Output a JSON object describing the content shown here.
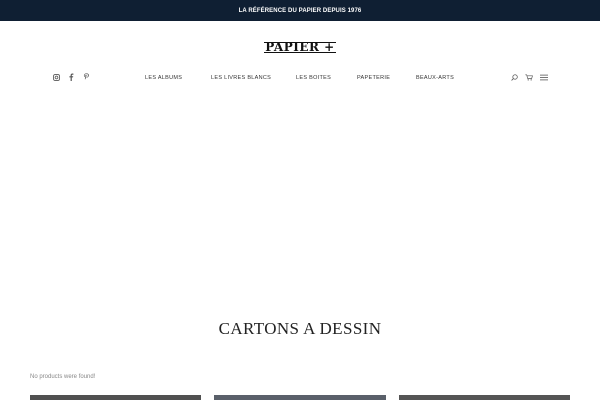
{
  "topbar": {
    "text": "LA RÉFÉRENCE DU PAPIER DEPUIS 1976",
    "bg_color": "#0f1f33"
  },
  "logo": {
    "text": "PAPIER +"
  },
  "social": {
    "icons": [
      "instagram-icon",
      "facebook-icon",
      "pinterest-icon"
    ]
  },
  "nav": {
    "items": [
      {
        "label": "LES ALBUMS"
      },
      {
        "label": "LES LIVRES BLANCS"
      },
      {
        "label": "LES BOITES"
      },
      {
        "label": "PAPETERIE"
      },
      {
        "label": "BEAUX-ARTS"
      }
    ]
  },
  "tools": {
    "icons": [
      "search-icon",
      "cart-icon",
      "menu-icon"
    ]
  },
  "page": {
    "title": "CARTONS A DESSIN",
    "notice": "No products were found!"
  }
}
